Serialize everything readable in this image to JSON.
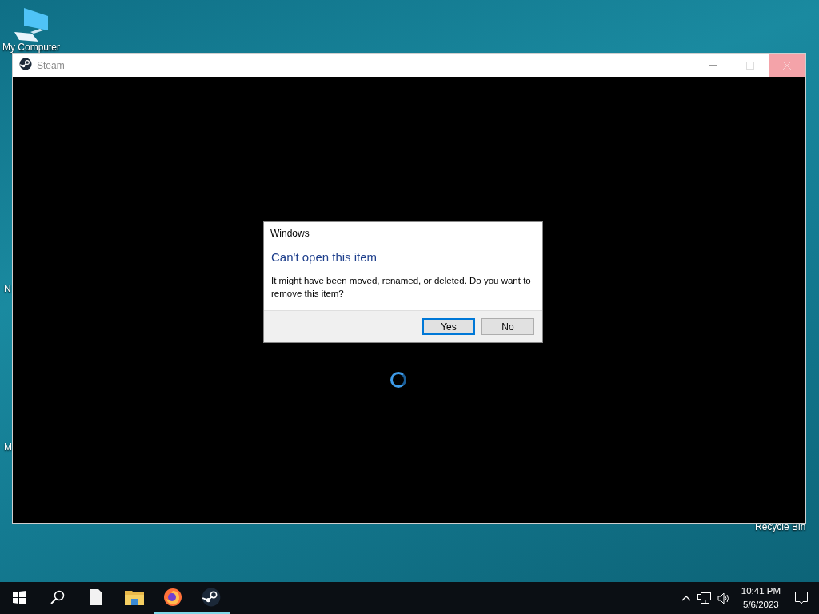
{
  "desktop": {
    "icons": [
      {
        "kind": "computer",
        "label": "My Computer"
      },
      {
        "kind": "fragment",
        "label": "N"
      },
      {
        "kind": "fragment",
        "label": "M"
      },
      {
        "kind": "fragment",
        "label": "Recycle Bin"
      }
    ]
  },
  "window": {
    "title": "Steam",
    "loading": true
  },
  "dialog": {
    "title": "Windows",
    "heading": "Can't open this item",
    "message": "It might have been moved, renamed, or deleted. Do you want to remove this item?",
    "buttons": [
      {
        "label": "Yes",
        "default": true
      },
      {
        "label": "No",
        "default": false
      }
    ]
  },
  "taskbar": {
    "apps": [
      {
        "kind": "file",
        "running": false
      },
      {
        "kind": "folder",
        "running": false
      },
      {
        "kind": "firefox",
        "running": true
      },
      {
        "kind": "steam",
        "running": true
      }
    ],
    "time": "10:41 PM",
    "date": "5/6/2023"
  }
}
